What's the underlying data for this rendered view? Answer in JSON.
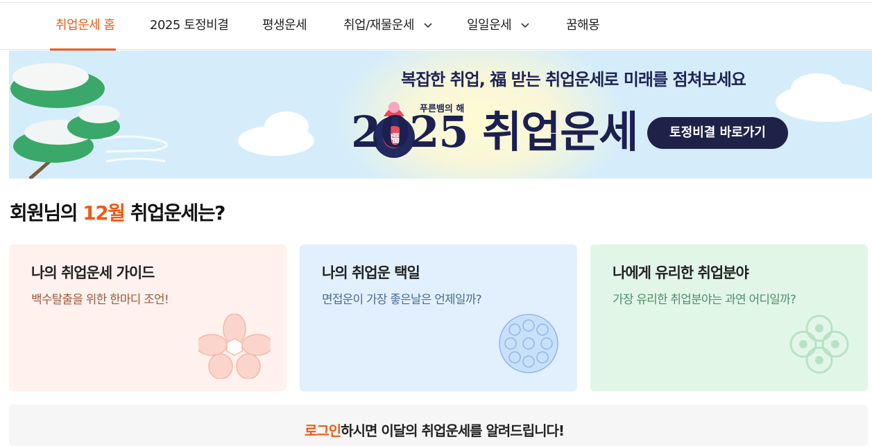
{
  "nav": {
    "items": [
      {
        "label": "취업운세 홈",
        "active": true
      },
      {
        "label": "2025 토정비결"
      },
      {
        "label": "평생운세"
      },
      {
        "label": "취업/재물운세",
        "dropdown": true
      },
      {
        "label": "일일운세",
        "dropdown": true
      },
      {
        "label": "꿈해몽"
      }
    ]
  },
  "banner": {
    "subtitle": "복잡한 취업, 福 받는 취업운세로 미래를 점쳐보세요",
    "tag": "푸른뱀의 해",
    "year_title": "2025 취업운세",
    "cta_label": "토정비결 바로가기"
  },
  "section": {
    "title_prefix": "회원님의 ",
    "title_month": "12월",
    "title_suffix": " 취업운세는?"
  },
  "cards": [
    {
      "title": "나의 취업운세 가이드",
      "desc": "백수탈출을 위한 한마디 조언!",
      "bg": "#fff1ee",
      "desc_color": "#9a5a40",
      "icon": "flower-icon"
    },
    {
      "title": "나의 취업운 택일",
      "desc": "면접운이 가장 좋은날은 언제일까?",
      "bg": "#e2f0fd",
      "desc_color": "#4a6b95",
      "icon": "pattern-circle-icon"
    },
    {
      "title": "나에게 유리한 취업분야",
      "desc": "가장 유리한 취업분야는 과연 어디일까?",
      "bg": "#e2f6e8",
      "desc_color": "#4d8f66",
      "icon": "knot-icon"
    }
  ],
  "bottom": {
    "accent": "로그인",
    "text": "하시면 이달의 취업운세를 알려드립니다!"
  },
  "colors": {
    "accent": "#f05a14",
    "navy": "#1f2248"
  }
}
